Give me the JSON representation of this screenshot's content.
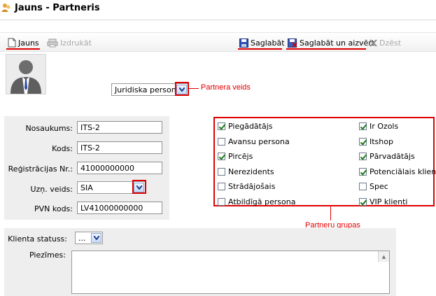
{
  "window": {
    "title": "Jauns - Partneris"
  },
  "toolbar": {
    "new_label": "Jauns",
    "print_label": "Izdrukāt",
    "save_label": "Saglabāt",
    "save_close_label": "Saglabāt un aizvērt",
    "delete_label": "Dzēst"
  },
  "partner_type": {
    "value": "Juridiska persona",
    "annotation": "Partnera veids"
  },
  "form": {
    "name_label": "Nosaukums:",
    "name_value": "ITS-2",
    "code_label": "Kods:",
    "code_value": "ITS-2",
    "reg_label": "Reģistrācijas Nr.:",
    "reg_value": "41000000000",
    "type_label": "Uzņ. veids:",
    "type_value": "SIA",
    "vat_label": "PVN kods:",
    "vat_value": "LV41000000000"
  },
  "groups": {
    "annotation": "Partneru grupas",
    "left": [
      {
        "label": "Piegādātājs",
        "checked": true
      },
      {
        "label": "Avansu persona",
        "checked": false
      },
      {
        "label": "Pircējs",
        "checked": true
      },
      {
        "label": "Nerezidents",
        "checked": false
      },
      {
        "label": "Strādājošais",
        "checked": false
      },
      {
        "label": "Atbildīgā persona",
        "checked": false
      }
    ],
    "right": [
      {
        "label": "Ir Ozols",
        "checked": true
      },
      {
        "label": "Itshop",
        "checked": true
      },
      {
        "label": "Pārvadātājs",
        "checked": true
      },
      {
        "label": "Potenciālais klients",
        "checked": true
      },
      {
        "label": "Spec",
        "checked": false
      },
      {
        "label": "VIP klienti",
        "checked": true
      }
    ]
  },
  "client_status": {
    "label": "Klienta statuss:",
    "value": "..."
  },
  "notes": {
    "label": "Piezīmes:"
  }
}
